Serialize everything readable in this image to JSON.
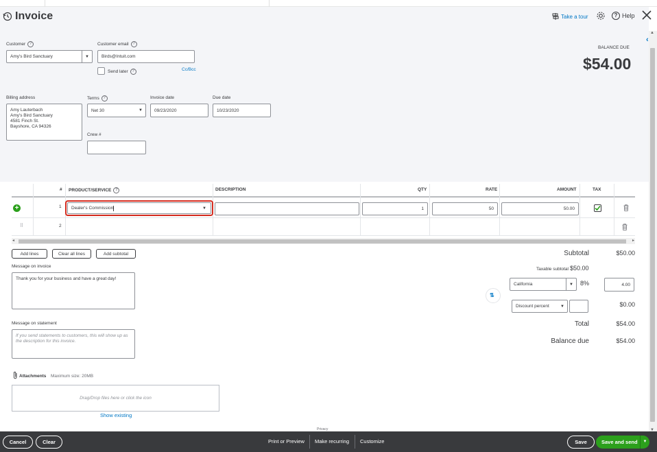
{
  "header": {
    "title": "Invoice",
    "take_tour": "Take a tour",
    "help": "Help"
  },
  "customer": {
    "label": "Customer",
    "value": "Amy's Bird Sanctuary",
    "email_label": "Customer email",
    "email_value": "Birds@Intuit.com",
    "send_later": "Send later",
    "cc_bcc": "Cc/Bcc"
  },
  "balance": {
    "label": "BALANCE DUE",
    "amount": "$54.00"
  },
  "billing": {
    "label": "Billing address",
    "lines": [
      "Amy Lauterbach",
      "Amy's Bird Sanctuary",
      "4581 Finch St.",
      "Bayshore, CA  94326"
    ]
  },
  "terms": {
    "label": "Terms",
    "value": "Net 30"
  },
  "invoice_date": {
    "label": "Invoice date",
    "value": "09/23/2020"
  },
  "due_date": {
    "label": "Due date",
    "value": "10/23/2020"
  },
  "crew": {
    "label": "Crew #",
    "value": ""
  },
  "table": {
    "headers": {
      "num": "#",
      "product": "PRODUCT/SERVICE",
      "description": "DESCRIPTION",
      "qty": "QTY",
      "rate": "RATE",
      "amount": "AMOUNT",
      "tax": "TAX"
    },
    "rows": [
      {
        "num": "1",
        "product": "Dealer's Commission",
        "description": "",
        "qty": "1",
        "rate": "50",
        "amount": "50.00",
        "tax": true
      },
      {
        "num": "2",
        "product": "",
        "description": "",
        "qty": "",
        "rate": "",
        "amount": "",
        "tax": false
      }
    ]
  },
  "buttons": {
    "add_lines": "Add lines",
    "clear_all_lines": "Clear all lines",
    "add_subtotal": "Add subtotal"
  },
  "message_invoice": {
    "label": "Message on invoice",
    "value": "Thank you for your business and have a great day!"
  },
  "message_statement": {
    "label": "Message on statement",
    "placeholder": "If you send statements to customers, this will show up as the description for this invoice."
  },
  "attachments": {
    "label": "Attachments",
    "max_size": "Maximum size: 20MB",
    "drop_hint": "Drag/Drop files here or click the icon",
    "show_existing": "Show existing"
  },
  "totals": {
    "subtotal_label": "Subtotal",
    "subtotal_value": "$50.00",
    "taxable_label": "Taxable subtotal",
    "taxable_value": "$50.00",
    "tax_region": "California",
    "tax_rate": "8%",
    "tax_amount": "4.00",
    "discount_type": "Discount percent",
    "discount_value": "",
    "discount_amount": "$0.00",
    "total_label": "Total",
    "total_value": "$54.00",
    "balance_label": "Balance due",
    "balance_value": "$54.00"
  },
  "footer": {
    "privacy": "Privacy",
    "cancel": "Cancel",
    "clear": "Clear",
    "print_preview": "Print or Preview",
    "make_recurring": "Make recurring",
    "customize": "Customize",
    "save": "Save",
    "save_and_send": "Save and send"
  },
  "colors": {
    "accent_green": "#2ca01c",
    "link_blue": "#0077c5",
    "footer_bg": "#393a3d",
    "highlight_red": "#d52b1e"
  }
}
